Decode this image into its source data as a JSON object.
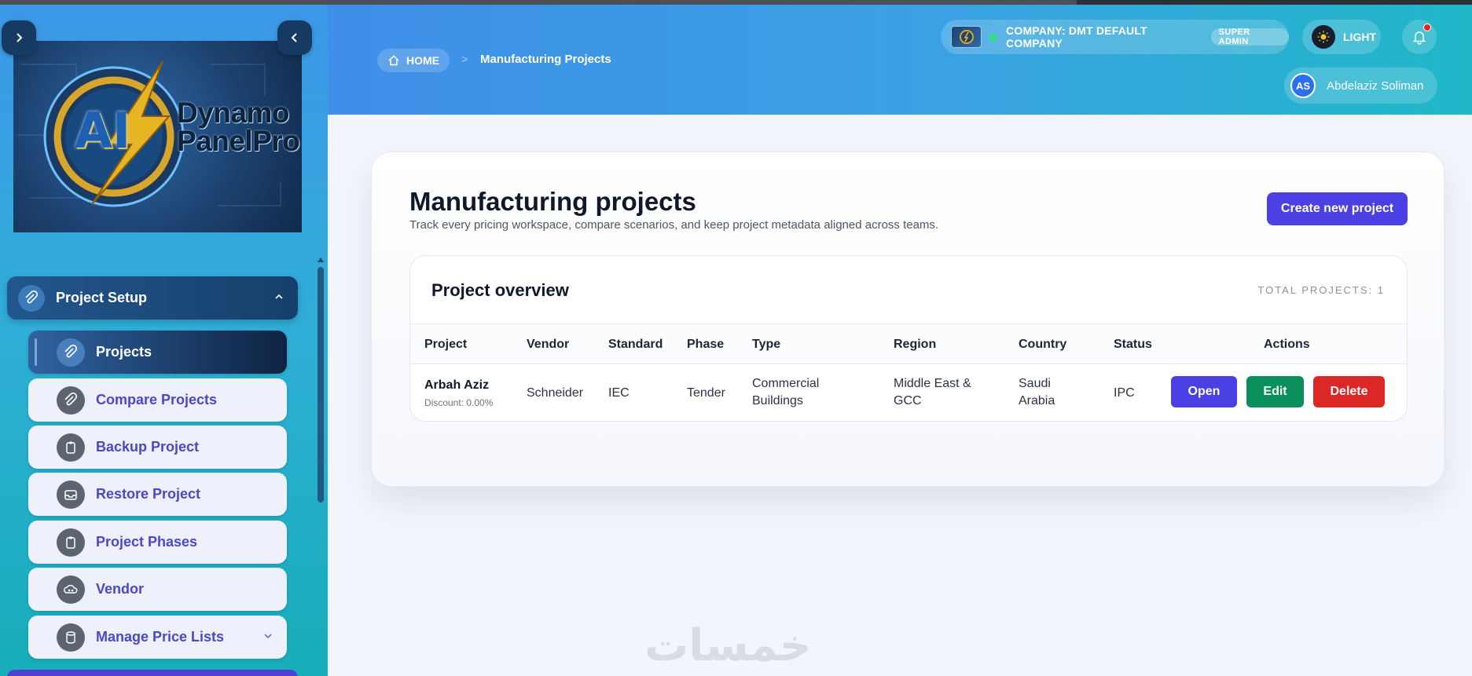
{
  "sidebar": {
    "logo_text_line1": "Dynamo",
    "logo_text_line2": "PanelPro",
    "logo_mark": "AI",
    "section": {
      "label": "Project Setup",
      "icon": "paperclip-icon"
    },
    "items": [
      {
        "label": "Projects",
        "icon": "paperclip-icon",
        "active": true
      },
      {
        "label": "Compare Projects",
        "icon": "paperclip-icon"
      },
      {
        "label": "Backup Project",
        "icon": "clipboard-icon"
      },
      {
        "label": "Restore Project",
        "icon": "inbox-icon"
      },
      {
        "label": "Project Phases",
        "icon": "clipboard-icon"
      },
      {
        "label": "Vendor",
        "icon": "cloud-network-icon"
      },
      {
        "label": "Manage Price Lists",
        "icon": "database-icon"
      }
    ]
  },
  "header": {
    "breadcrumb_home": "HOME",
    "breadcrumb_separator": ">",
    "breadcrumb_current": "Manufacturing Projects",
    "company_label": "COMPANY: DMT DEFAULT COMPANY",
    "role_badge": "SUPER ADMIN",
    "theme_label": "LIGHT",
    "user_initials": "AS",
    "user_name": "Abdelaziz Soliman"
  },
  "main": {
    "title": "Manufacturing projects",
    "subtitle": "Track every pricing workspace, compare scenarios, and keep project metadata aligned across teams.",
    "create_button": "Create new project",
    "overview": {
      "title": "Project overview",
      "total_label": "TOTAL PROJECTS: 1",
      "columns": [
        "Project",
        "Vendor",
        "Standard",
        "Phase",
        "Type",
        "Region",
        "Country",
        "Status",
        "Actions"
      ],
      "rows": [
        {
          "project": "Arbah Aziz",
          "discount": "Discount: 0.00%",
          "vendor": "Schneider",
          "standard": "IEC",
          "phase": "Tender",
          "type_line1": "Commercial",
          "type_line2": "Buildings",
          "region_line1": "Middle East &",
          "region_line2": "GCC",
          "country_line1": "Saudi",
          "country_line2": "Arabia",
          "status": "IPC",
          "open": "Open",
          "edit": "Edit",
          "delete": "Delete"
        }
      ]
    }
  },
  "watermark": "خمسات",
  "colors": {
    "primary": "#4b40e3",
    "success": "#0b8f5c",
    "danger": "#dc2727",
    "sidebar_dark": "#163f6b"
  }
}
